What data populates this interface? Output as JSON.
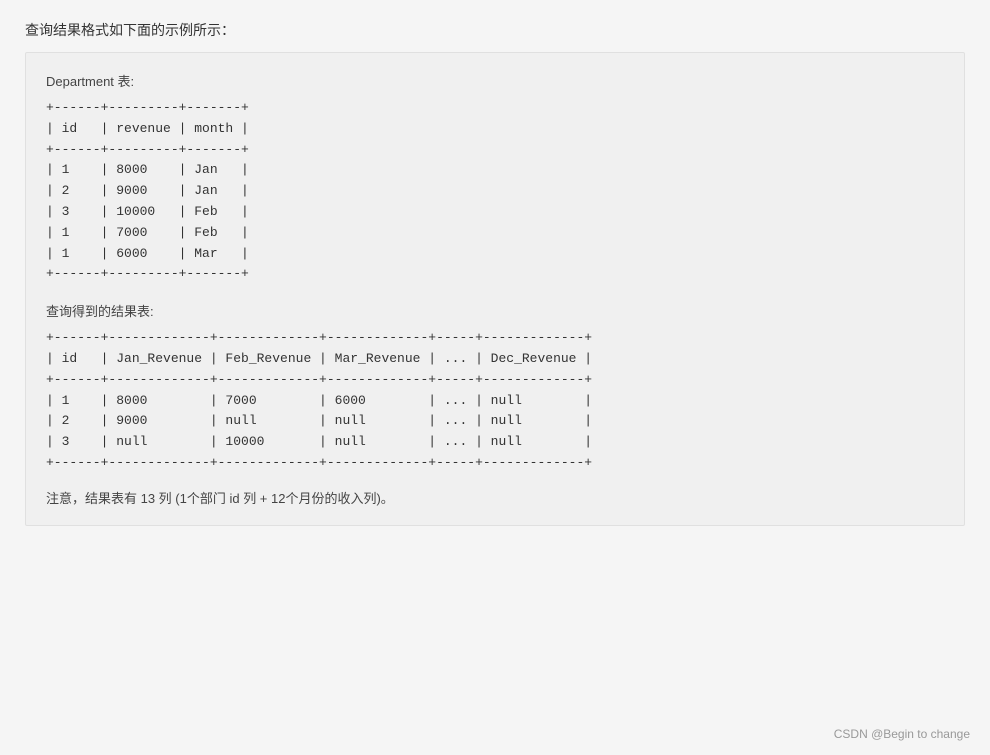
{
  "page": {
    "intro": "查询结果格式如下面的示例所示：",
    "department_label": "Department 表:",
    "department_table": "+------+---------+-------+\n| id   | revenue | month |\n+------+---------+-------+\n| 1    | 8000    | Jan   |\n| 2    | 9000    | Jan   |\n| 3    | 10000   | Feb   |\n| 1    | 7000    | Feb   |\n| 1    | 6000    | Mar   |\n+------+---------+-------+",
    "result_label": "查询得到的结果表:",
    "result_table": "+------+-------------+-------------+-------------+-----+-------------+\n| id   | Jan_Revenue | Feb_Revenue | Mar_Revenue | ... | Dec_Revenue |\n+------+-------------+-------------+-------------+-----+-------------+\n| 1    | 8000        | 7000        | 6000        | ... | null        |\n| 2    | 9000        | null        | null        | ... | null        |\n| 3    | null        | 10000       | null        | ... | null        |\n+------+-------------+-------------+-------------+-----+-------------+",
    "footer_note": "注意，结果表有 13 列 (1个部门 id 列 + 12个月份的收入列)。",
    "attribution": "CSDN @Begin to change"
  }
}
